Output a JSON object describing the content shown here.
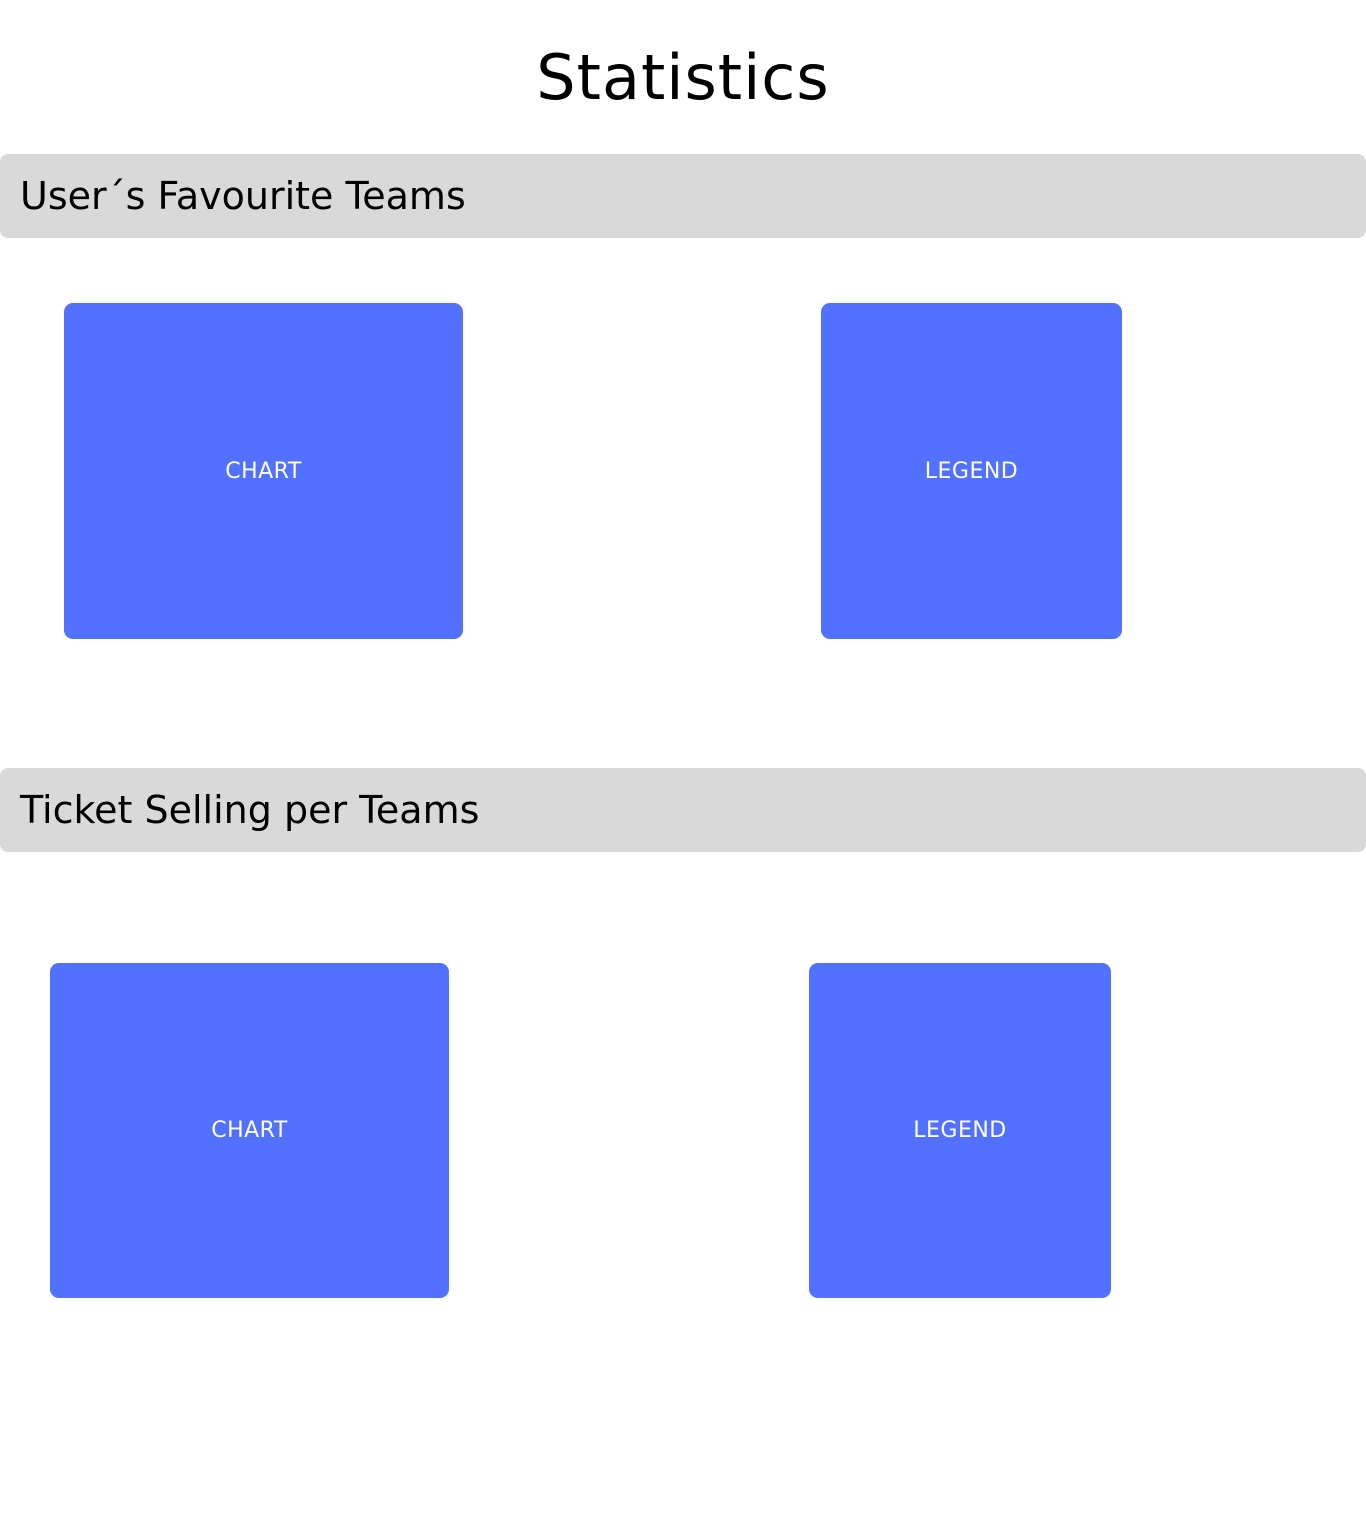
{
  "page": {
    "title": "Statistics"
  },
  "sections": [
    {
      "heading": "User´s Favourite Teams",
      "chart_label": "CHART",
      "legend_label": "LEGEND"
    },
    {
      "heading": "Ticket Selling per Teams",
      "chart_label": "CHART",
      "legend_label": "LEGEND"
    }
  ],
  "colors": {
    "accent": "#5271ff",
    "section_bar": "#d9d9d9",
    "background": "#ffffff"
  }
}
